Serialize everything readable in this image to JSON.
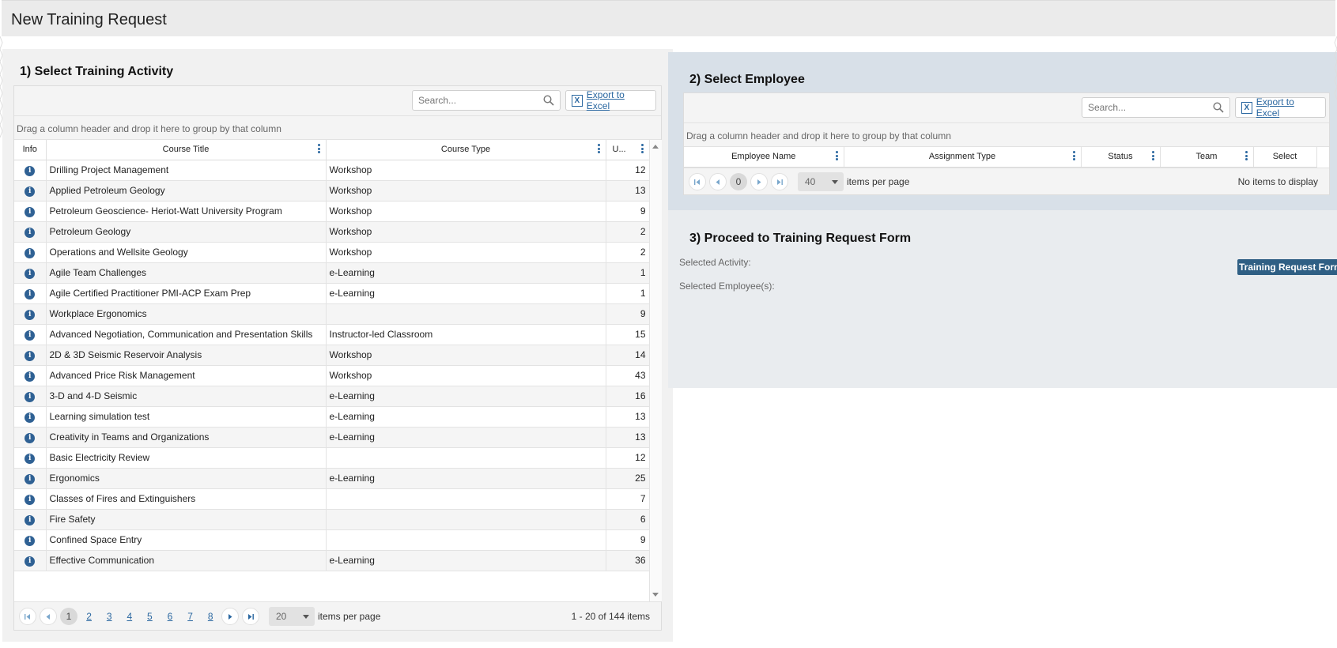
{
  "page": {
    "title": "New Training Request"
  },
  "activity": {
    "section_title": "1) Select Training Activity",
    "search_placeholder": "Search...",
    "export_label": "Export to Excel",
    "group_hint": "Drag a column header and drop it here to group by that column",
    "columns": {
      "info": "Info",
      "title": "Course Title",
      "type": "Course Type",
      "units": "U..."
    },
    "rows": [
      {
        "title": "Drilling Project Management",
        "type": "Workshop",
        "units": "12"
      },
      {
        "title": "Applied Petroleum Geology",
        "type": "Workshop",
        "units": "13"
      },
      {
        "title": "Petroleum Geoscience- Heriot-Watt University Program",
        "type": "Workshop",
        "units": "9"
      },
      {
        "title": "Petroleum Geology",
        "type": "Workshop",
        "units": "2"
      },
      {
        "title": "Operations and Wellsite Geology",
        "type": "Workshop",
        "units": "2"
      },
      {
        "title": "Agile Team Challenges",
        "type": "e-Learning",
        "units": "1"
      },
      {
        "title": "Agile Certified Practitioner PMI-ACP Exam Prep",
        "type": "e-Learning",
        "units": "1"
      },
      {
        "title": "Workplace Ergonomics",
        "type": "",
        "units": "9"
      },
      {
        "title": "Advanced Negotiation, Communication and Presentation Skills",
        "type": "Instructor-led Classroom",
        "units": "15"
      },
      {
        "title": "2D & 3D Seismic Reservoir Analysis",
        "type": "Workshop",
        "units": "14"
      },
      {
        "title": "Advanced Price Risk Management",
        "type": "Workshop",
        "units": "43"
      },
      {
        "title": "3-D and 4-D Seismic",
        "type": "e-Learning",
        "units": "16"
      },
      {
        "title": "Learning simulation test",
        "type": "e-Learning",
        "units": "13"
      },
      {
        "title": "Creativity in Teams and Organizations",
        "type": "e-Learning",
        "units": "13"
      },
      {
        "title": "Basic Electricity Review",
        "type": "",
        "units": "12"
      },
      {
        "title": "Ergonomics",
        "type": "e-Learning",
        "units": "25"
      },
      {
        "title": "Classes of Fires and Extinguishers",
        "type": "",
        "units": "7"
      },
      {
        "title": "Fire Safety",
        "type": "",
        "units": "6"
      },
      {
        "title": "Confined Space Entry",
        "type": "",
        "units": "9"
      },
      {
        "title": "Effective Communication",
        "type": "e-Learning",
        "units": "36"
      }
    ],
    "pager": {
      "pages": [
        "1",
        "2",
        "3",
        "4",
        "5",
        "6",
        "7",
        "8"
      ],
      "current_page": "1",
      "page_size": "20",
      "items_per_page": "items per page",
      "summary": "1 - 20 of 144 items"
    }
  },
  "employee": {
    "section_title": "2) Select Employee",
    "search_placeholder": "Search...",
    "export_label": "Export to Excel",
    "group_hint": "Drag a column header and drop it here to group by that column",
    "columns": {
      "name": "Employee Name",
      "assignment": "Assignment Type",
      "status": "Status",
      "team": "Team",
      "select": "Select"
    },
    "pager": {
      "page": "0",
      "page_size": "40",
      "items_per_page": "items per page",
      "summary": "No items to display"
    }
  },
  "proceed": {
    "section_title": "3) Proceed to Training Request Form",
    "selected_activity_label": "Selected Activity:",
    "selected_employees_label": "Selected Employee(s):",
    "form_button": "Training Request Form"
  },
  "colors": {
    "accent": "#2a67a0",
    "info_icon": "#2f6194",
    "form_button": "#2f5f84",
    "employee_bg": "#d8e0e8"
  }
}
